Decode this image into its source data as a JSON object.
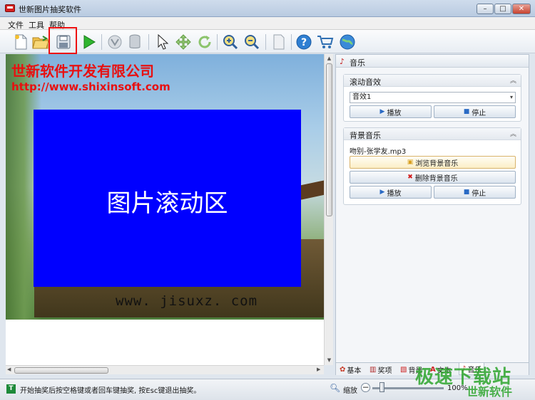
{
  "window": {
    "title": "世新图片抽奖软件",
    "controls": [
      "–",
      "□",
      "✕"
    ]
  },
  "menu": [
    "文件",
    "工具",
    "帮助"
  ],
  "toolbar": {
    "buttons": [
      "new-icon",
      "open-folder-icon",
      "save-icon",
      "play-icon",
      "filter-icon",
      "database-icon",
      "pointer-icon",
      "move-icon",
      "refresh-icon",
      "zoom-in-icon",
      "zoom-out-icon",
      "page-icon",
      "help-icon",
      "cart-icon",
      "globe-icon"
    ],
    "highlighted": "save-icon",
    "highlight_color": "#ee1111"
  },
  "canvas": {
    "company": "世新软件开发有限公司",
    "url": "http://www.shixinsoft.com",
    "scroll_area_label": "图片滚动区",
    "site": "www. jisuxz. com",
    "text_color": "#e81010",
    "box_color": "#0000ff"
  },
  "panel": {
    "title": "音乐",
    "scroll_sound": {
      "title": "滚动音效",
      "selected": "音效1",
      "play": "播放",
      "stop": "停止"
    },
    "bg_music": {
      "title": "背景音乐",
      "file": "吻别-张学友.mp3",
      "browse": "浏览背景音乐",
      "delete": "删除背景音乐",
      "play": "播放",
      "stop": "停止"
    },
    "tabs": [
      "基本",
      "奖项",
      "背景",
      "文本",
      "音乐"
    ],
    "active_tab": "音乐"
  },
  "status": {
    "message": "开始抽奖后按空格键或者回车键抽奖, 按Esc键退出抽奖。",
    "zoom_label": "缩放",
    "zoom_value": "100%",
    "brand": "极速下载站",
    "brand_sub": "世新软件"
  }
}
